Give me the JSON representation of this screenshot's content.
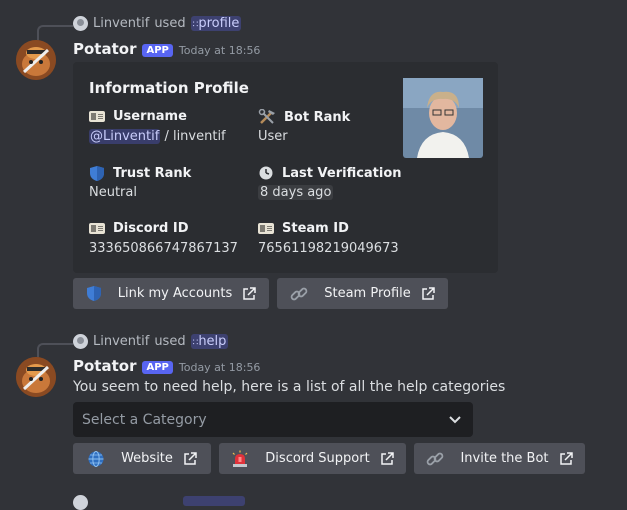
{
  "message1": {
    "reply": {
      "user": "Linventif",
      "used": "used",
      "command": "profile"
    },
    "author": "Potator",
    "badge": "APP",
    "timestamp": "Today at 18:56",
    "embed": {
      "title": "Information Profile",
      "fields": {
        "username": {
          "name": "Username",
          "mention": "@Linventif",
          "rest": " / linventif"
        },
        "bot_rank": {
          "name": "Bot Rank",
          "value": "User"
        },
        "trust_rank": {
          "name": "Trust Rank",
          "value": "Neutral"
        },
        "last_verification": {
          "name": "Last Verification",
          "value": "8 days ago"
        },
        "discord_id": {
          "name": "Discord ID",
          "value": "333650866747867137"
        },
        "steam_id": {
          "name": "Steam ID",
          "value": "76561198219049673"
        }
      }
    },
    "buttons": [
      {
        "label": "Link my Accounts",
        "icon": "shield-icon"
      },
      {
        "label": "Steam Profile",
        "icon": "link-icon"
      }
    ]
  },
  "message2": {
    "reply": {
      "user": "Linventif",
      "used": "used",
      "command": "help"
    },
    "author": "Potator",
    "badge": "APP",
    "timestamp": "Today at 18:56",
    "text": "You seem to need help, here is a list of all the help categories",
    "select": {
      "placeholder": "Select a Category"
    },
    "buttons": [
      {
        "label": "Website",
        "icon": "globe-icon"
      },
      {
        "label": "Discord Support",
        "icon": "siren-icon"
      },
      {
        "label": "Invite the Bot",
        "icon": "link-icon"
      }
    ]
  },
  "colors": {
    "background": "#313338",
    "embed": "#2b2d31",
    "button": "#4e5058",
    "accent": "#5865f2"
  }
}
